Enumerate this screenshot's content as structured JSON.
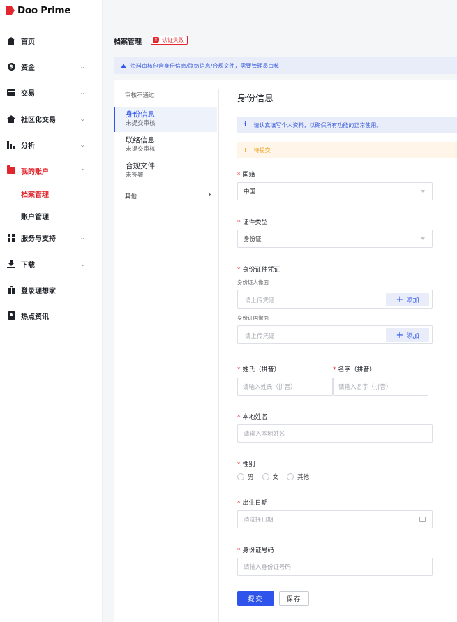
{
  "brand": {
    "name": "Doo Prime",
    "color": "#e1262d"
  },
  "sidebar": {
    "items": [
      {
        "label": "首页",
        "icon": "home-icon",
        "expandable": false
      },
      {
        "label": "资金",
        "icon": "dollar-coin-icon",
        "expandable": true
      },
      {
        "label": "交易",
        "icon": "card-icon",
        "expandable": true
      },
      {
        "label": "社区化交易",
        "icon": "community-icon",
        "expandable": true
      },
      {
        "label": "分析",
        "icon": "bar-chart-icon",
        "expandable": true
      },
      {
        "label": "我的账户",
        "icon": "folder-icon",
        "expandable": true,
        "expanded": true,
        "active": true
      },
      {
        "label": "服务与支持",
        "icon": "grid-icon",
        "expandable": true
      },
      {
        "label": "下载",
        "icon": "download-icon",
        "expandable": true
      },
      {
        "label": "登录理想家",
        "icon": "gift-icon",
        "expandable": false
      },
      {
        "label": "热点资讯",
        "icon": "news-pin-icon",
        "expandable": false
      }
    ],
    "subitems": [
      {
        "label": "档案管理",
        "active": true
      },
      {
        "label": "账户管理",
        "active": false
      }
    ]
  },
  "header": {
    "title": "档案管理",
    "status_badge": "认证失败",
    "banner": "资料审核包含身份信息/联络信息/合规文件，需要管理员审核"
  },
  "steps": {
    "header": "审核不通过",
    "items": [
      {
        "name": "身份信息",
        "status": "未提交审核",
        "active": true
      },
      {
        "name": "联络信息",
        "status": "未提交审核",
        "active": false
      },
      {
        "name": "合规文件",
        "status": "未签署",
        "active": false
      }
    ],
    "other": "其他"
  },
  "form": {
    "section_title": "身份信息",
    "notice": "请认真填写个人资料，以确保所有功能的正常使用。",
    "warning": "待提交",
    "nationality": {
      "label": "国籍",
      "value": "中国"
    },
    "id_type": {
      "label": "证件类型",
      "value": "身份证"
    },
    "id_proof": {
      "label": "身份证件凭证",
      "front_label": "身份证人像面",
      "back_label": "身份证国徽面",
      "placeholder": "请上传凭证",
      "add_label": "添加"
    },
    "surname": {
      "label": "姓氏（拼音）",
      "placeholder": "请输入姓氏（拼音）"
    },
    "given_name": {
      "label": "名字（拼音）",
      "placeholder": "请输入名字（拼音）"
    },
    "local_name": {
      "label": "本地姓名",
      "placeholder": "请输入本地姓名"
    },
    "gender": {
      "label": "性别",
      "options": [
        "男",
        "女",
        "其他"
      ]
    },
    "birth_date": {
      "label": "出生日期",
      "placeholder": "请选择日期"
    },
    "id_number": {
      "label": "身份证号码",
      "placeholder": "请输入身份证号码"
    },
    "submit_label": "提交",
    "save_label": "保存"
  },
  "colors": {
    "accent": "#2f54eb",
    "danger": "#e1262d",
    "warning": "#f0a020"
  }
}
